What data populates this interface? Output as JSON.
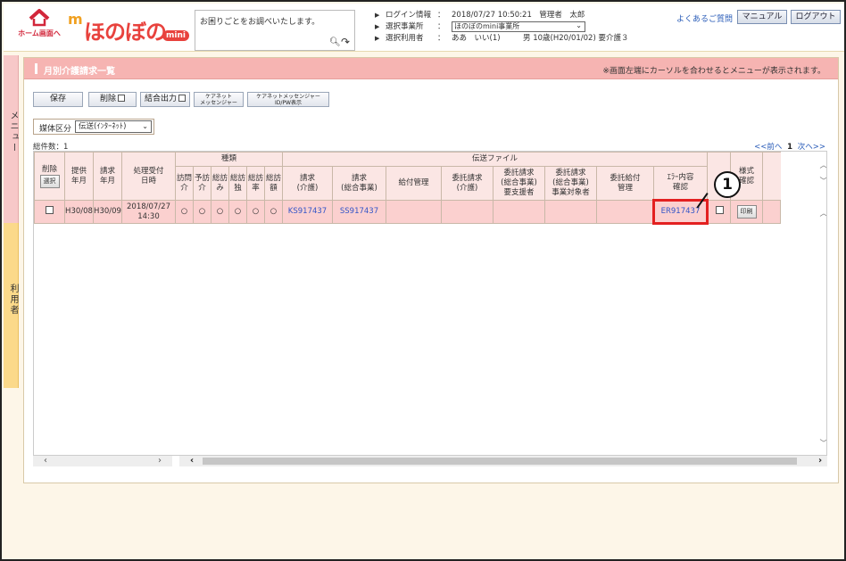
{
  "header": {
    "home_label": "ホーム画面へ",
    "logo_text": "ほのぼの",
    "logo_sub": "mini",
    "search_placeholder": "お困りごとをお調べいたします。",
    "login_label": "ログイン情報",
    "login_value": "2018/07/27 10:50:21　管理者　太郎",
    "office_label": "選択事業所",
    "office_value": "ほのぼのmini事業所",
    "user_label": "選択利用者",
    "user_value": "ああ　いい(1)　　　男 10歳(H20/01/02) 要介護３",
    "faq": "よくあるご質問",
    "manual": "マニュアル",
    "logout": "ログアウト"
  },
  "side": {
    "menu": "メニュー",
    "user": "利用者"
  },
  "panel": {
    "title": "月別介護請求一覧",
    "note": "※画面左端にカーソルを合わせるとメニューが表示されます。",
    "toolbar": {
      "save": "保存",
      "delete": "削除",
      "combined": "結合出力",
      "caremgr1": "ケアネット",
      "caremgr2": "メッセンジャー",
      "caremgr_pw1": "ケアネットメッセンジャー",
      "caremgr_pw2": "ID/PW表示"
    },
    "media_label": "媒体区分",
    "media_value": "伝送(ｲﾝﾀｰﾈｯﾄ)",
    "total": "総件数：1",
    "pager_prev": "<<前へ",
    "pager_page": "1",
    "pager_next": "次へ>>"
  },
  "table": {
    "h_delete": "削除",
    "h_select": "選択",
    "h_provide": "提供\n年月",
    "h_bill": "請求\n年月",
    "h_received": "処理受付\n日時",
    "h_kind": "種類",
    "kinds": [
      "訪問介",
      "予訪介",
      "総訪み",
      "総訪独",
      "総訪率",
      "総訪額"
    ],
    "h_transfer": "伝送ファイル",
    "h_claim_care": "請求\n(介護)",
    "h_claim_general": "請求\n(総合事業)",
    "h_benefit": "給付管理",
    "h_consign_care": "委託請求\n(介護)",
    "h_consign_support": "委託請求\n(総合事業)\n要支援者",
    "h_consign_target": "委託請求\n(総合事業)\n事業対象者",
    "h_consign_benefit": "委託給付\n管理",
    "h_error": "ｴﾗｰ内容\n確認",
    "h_style": "様式\n確認",
    "row": {
      "provide": "H30/08",
      "bill": "H30/09",
      "received": "2018/07/27\n14:30",
      "marks": [
        "○",
        "○",
        "○",
        "○",
        "○",
        "○"
      ],
      "claim_care": "KS917437",
      "claim_general": "SS917437",
      "error": "ER917437",
      "print": "印刷"
    }
  },
  "callout": "1"
}
